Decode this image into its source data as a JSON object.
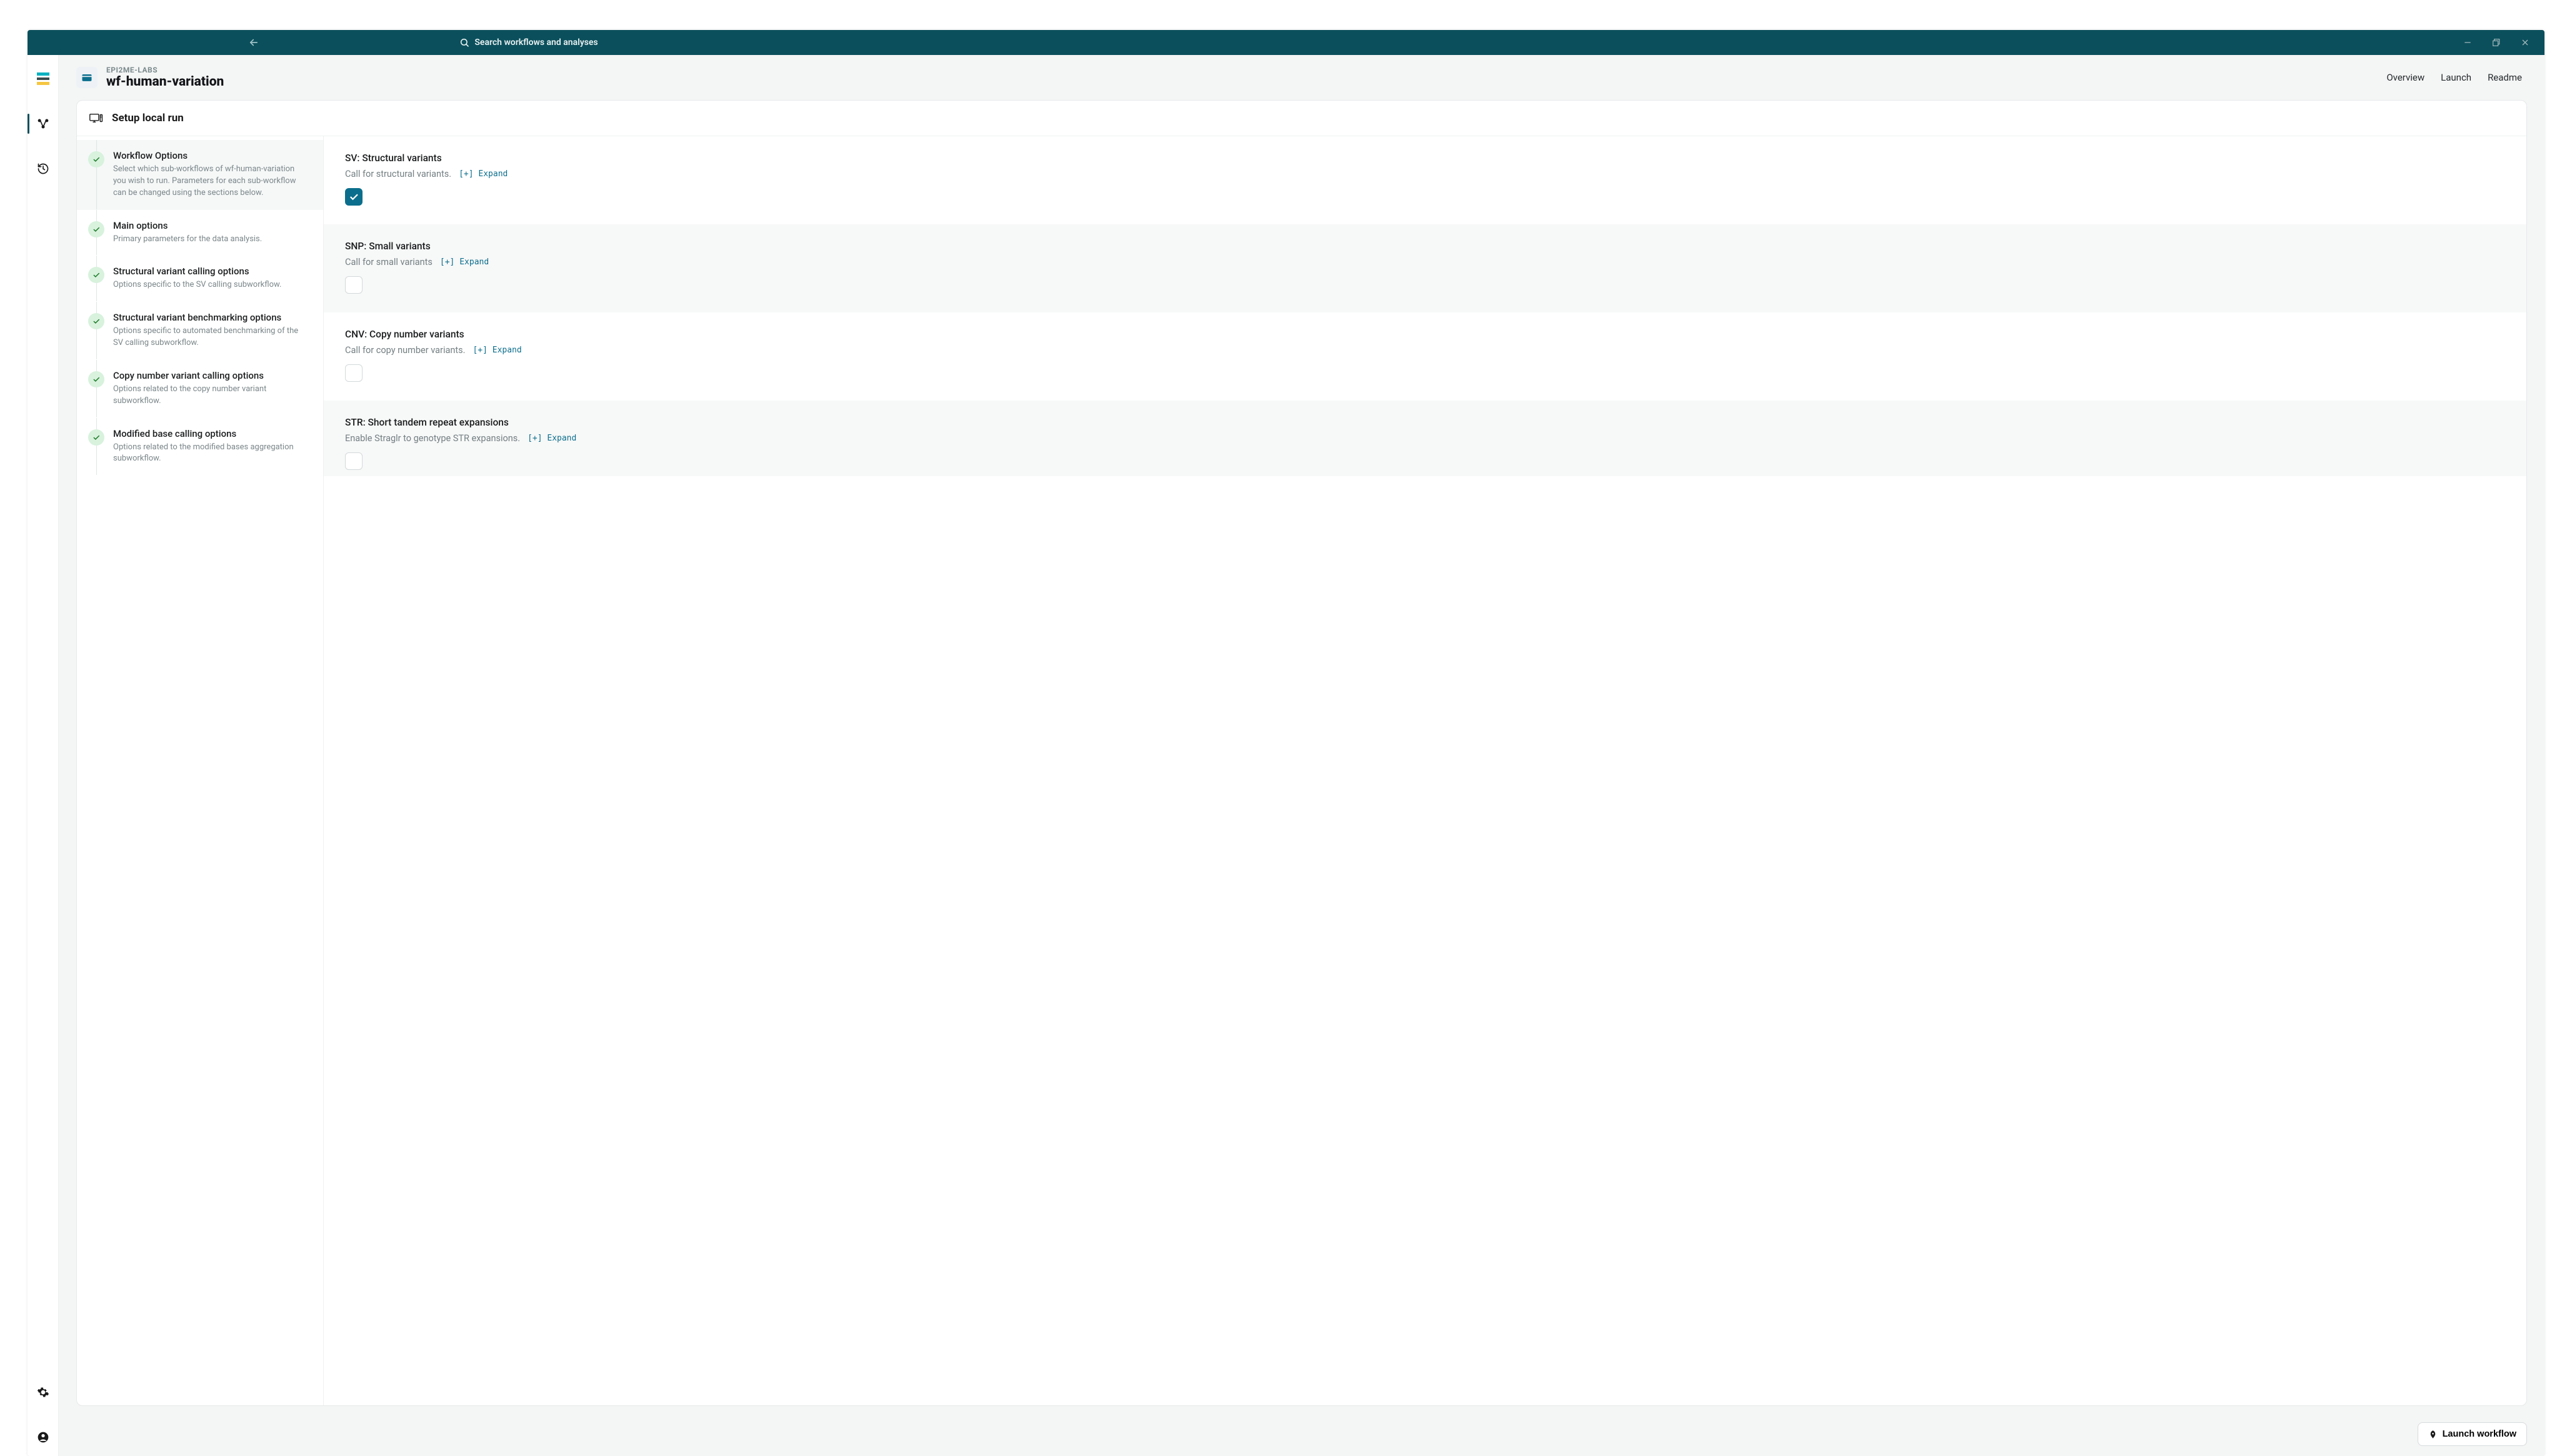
{
  "titlebar": {
    "search_placeholder": "Search workflows and analyses"
  },
  "header": {
    "org": "EPI2ME-LABS",
    "workflow_name": "wf-human-variation",
    "tabs": {
      "overview": "Overview",
      "launch": "Launch",
      "readme": "Readme"
    }
  },
  "card": {
    "title": "Setup local run"
  },
  "steps": [
    {
      "title": "Workflow Options",
      "desc": "Select which sub-workflows of wf-human-variation you wish to run. Parameters for each sub-workflow can be changed using the sections below."
    },
    {
      "title": "Main options",
      "desc": "Primary parameters for the data analysis."
    },
    {
      "title": "Structural variant calling options",
      "desc": "Options specific to the SV calling subworkflow."
    },
    {
      "title": "Structural variant benchmarking options",
      "desc": "Options specific to automated benchmarking of the SV calling subworkflow."
    },
    {
      "title": "Copy number variant calling options",
      "desc": "Options related to the copy number variant subworkflow."
    },
    {
      "title": "Modified base calling options",
      "desc": "Options related to the modified bases aggregation subworkflow."
    }
  ],
  "options": [
    {
      "title": "SV: Structural variants",
      "desc": "Call for structural variants.",
      "expand": "[+] Expand",
      "checked": true
    },
    {
      "title": "SNP: Small variants",
      "desc": "Call for small variants",
      "expand": "[+] Expand",
      "checked": false
    },
    {
      "title": "CNV: Copy number variants",
      "desc": "Call for copy number variants.",
      "expand": "[+] Expand",
      "checked": false
    },
    {
      "title": "STR: Short tandem repeat expansions",
      "desc": "Enable Straglr to genotype STR expansions.",
      "expand": "[+] Expand",
      "checked": false
    }
  ],
  "footer": {
    "launch_label": "Launch workflow"
  }
}
